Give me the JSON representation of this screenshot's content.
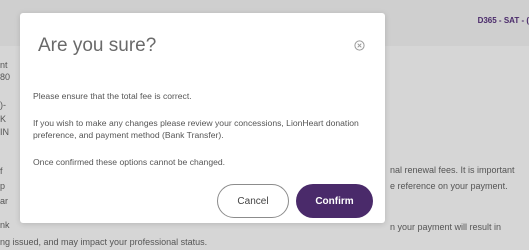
{
  "background": {
    "header_tag": "D365 - SAT - (",
    "fragments": [
      "nt",
      "80",
      ")-",
      "K",
      "IN",
      "f",
      "p",
      "ar",
      "nk",
      "nal renewal fees. It is important",
      "e reference on your payment.",
      "n your payment will result in",
      "ng issued, and may impact your professional status."
    ]
  },
  "modal": {
    "title": "Are you sure?",
    "close_icon": "close-circle-icon",
    "paragraphs": [
      "Please ensure that the total fee is correct.",
      "If you wish to make any changes please review your concessions, LionHeart donation preference, and payment method (Bank Transfer).",
      "Once confirmed these options cannot be changed."
    ],
    "cancel_label": "Cancel",
    "confirm_label": "Confirm"
  },
  "colors": {
    "accent": "#4a2a6a",
    "overlay": "#d6d6d6"
  }
}
